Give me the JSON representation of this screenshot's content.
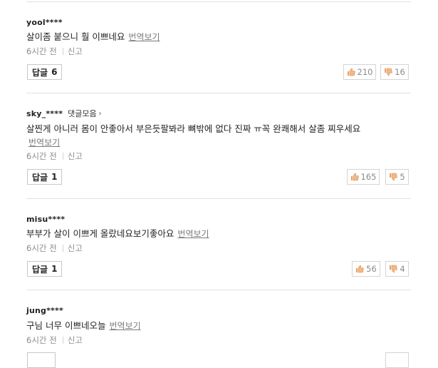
{
  "comments": [
    {
      "username": "yool****",
      "collect_label": "",
      "text": "살이좀 붙으니 훨 이쁘네요",
      "translate": "번역보기",
      "time": "6시간 전",
      "report": "신고",
      "reply_label": "답글",
      "reply_count": "6",
      "likes": "210",
      "dislikes": "16"
    },
    {
      "username": "sky_****",
      "collect_label": "댓글모음",
      "text": "살찐게 아니러 몸이 안좋아서 부은듯팔봐라 뼈밖에 없다 진짜 ㅠ꼭 완쾌해서 살좀 찌우세요",
      "translate": "번역보기",
      "time": "6시간 전",
      "report": "신고",
      "reply_label": "답글",
      "reply_count": "1",
      "likes": "165",
      "dislikes": "5"
    },
    {
      "username": "misu****",
      "collect_label": "",
      "text": "부부가 살이 이쁘게 올랐네요보기좋아요",
      "translate": "번역보기",
      "time": "6시간 전",
      "report": "신고",
      "reply_label": "답글",
      "reply_count": "1",
      "likes": "56",
      "dislikes": "4"
    },
    {
      "username": "jung****",
      "collect_label": "",
      "text": "구님 너무 이쁘네오늘",
      "translate": "번역보기",
      "time": "6시간 전",
      "report": "신고",
      "reply_label": "",
      "reply_count": "",
      "likes": "",
      "dislikes": ""
    }
  ],
  "icons": {
    "like": "thumbs-up-icon",
    "dislike": "thumbs-down-icon",
    "chevron": "chevron-right-icon"
  },
  "colors": {
    "like_icon": "#e8a06a",
    "dislike_icon": "#e8a06a",
    "divider": "#e2e2e2",
    "muted_text": "#8c8c8c"
  }
}
